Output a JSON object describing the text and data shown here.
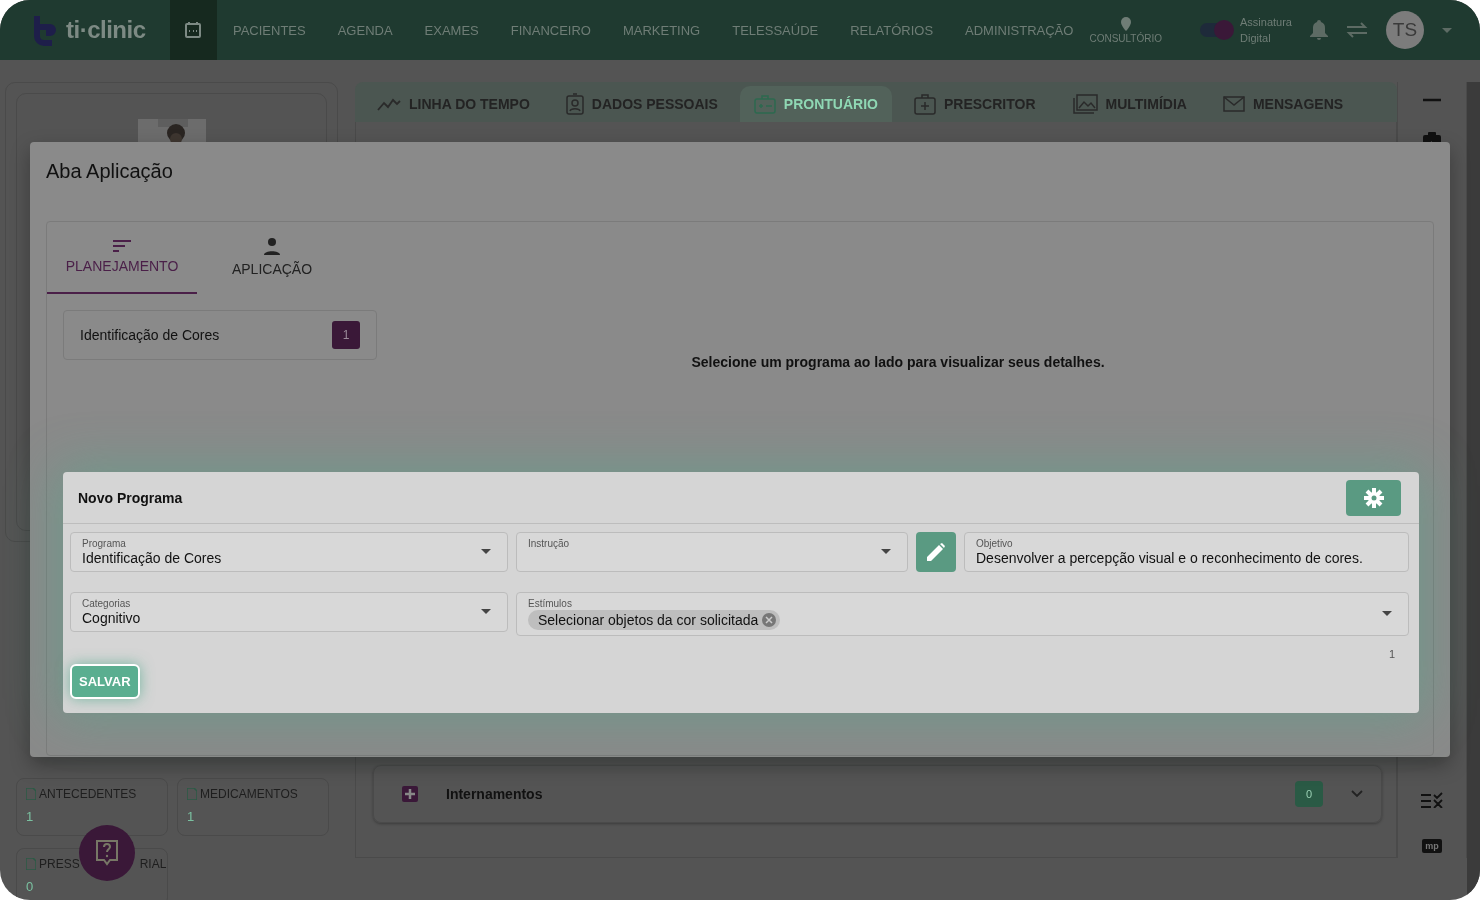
{
  "header": {
    "logo": "ti·clinic",
    "nav": [
      "PACIENTES",
      "AGENDA",
      "EXAMES",
      "FINANCEIRO",
      "MARKETING",
      "TELESSAÚDE",
      "RELATÓRIOS",
      "ADMINISTRAÇÃO"
    ],
    "location": "CONSULTÓRIO",
    "signature": {
      "label_lines": [
        "Assinatura",
        "Digital"
      ],
      "on": true
    },
    "avatar": "TS"
  },
  "patient_tabs": [
    {
      "label": "LINHA DO TEMPO",
      "selected": false
    },
    {
      "label": "DADOS PESSOAIS",
      "selected": false
    },
    {
      "label": "PRONTUÁRIO",
      "selected": true
    },
    {
      "label": "PRESCRITOR",
      "selected": false
    },
    {
      "label": "MULTIMÍDIA",
      "selected": false
    },
    {
      "label": "MENSAGENS",
      "selected": false
    }
  ],
  "left_panel": {
    "cards": [
      {
        "label_parts": [
          "ANTECEDENTES"
        ],
        "count": "1"
      },
      {
        "label_parts": [
          "MEDICAMENTOS"
        ],
        "count": "1"
      },
      {
        "label_parts": [
          "PRESS",
          "RIAL"
        ],
        "count": "0"
      }
    ]
  },
  "history": {
    "title": "Internamentos",
    "count": "0"
  },
  "rail_badge": "mp",
  "modal": {
    "title": "Aba Aplicação",
    "tabs": [
      {
        "label": "PLANEJAMENTO",
        "selected": true
      },
      {
        "label": "APLICAÇÃO",
        "selected": false
      }
    ],
    "programs": [
      {
        "name": "Identificação de Cores",
        "count": "1"
      }
    ],
    "empty_message": "Selecione um programa ao lado para visualizar seus detalhes.",
    "form": {
      "title": "Novo Programa",
      "programa": {
        "label": "Programa",
        "value": "Identificação de Cores"
      },
      "instrucao": {
        "label": "Instrução"
      },
      "objetivo": {
        "label": "Objetivo",
        "value": "Desenvolver a percepção visual e o reconhecimento de cores."
      },
      "categorias": {
        "label": "Categorias",
        "value": "Cognitivo"
      },
      "estimulos": {
        "label": "Estímulos",
        "chips": [
          "Selecionar objetos da cor solicitada"
        ],
        "counter": "1"
      },
      "save": "SALVAR"
    }
  }
}
